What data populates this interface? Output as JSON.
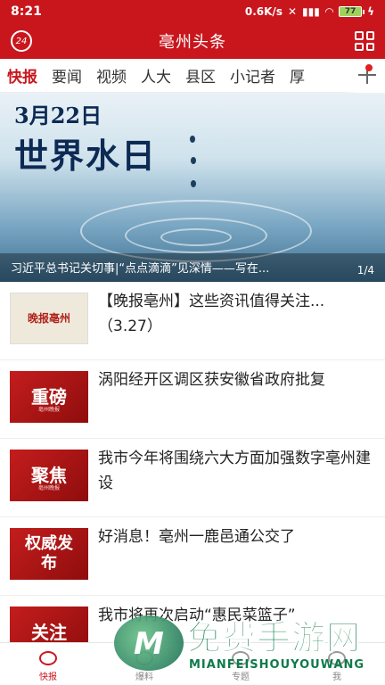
{
  "status_bar": {
    "time": "8:21",
    "net_speed": "0.6K/s",
    "battery_level": "77"
  },
  "header": {
    "badge": "24",
    "title": "亳州头条"
  },
  "tabs": [
    "快报",
    "要闻",
    "视频",
    "人大",
    "县区",
    "小记者",
    "厚"
  ],
  "active_tab": "快报",
  "banner": {
    "date_text": "3月22日",
    "headline_text": "世界水日",
    "caption": "习近平总书记关切事|“点点滴滴”见深情——写在...",
    "pager": "1/4"
  },
  "news": [
    {
      "thumb_text": "晚报亳州",
      "thumb_style": "paper",
      "title": "【晚报亳州】这些资讯值得关注...（3.27）"
    },
    {
      "thumb_text": "重磅",
      "thumb_style": "red",
      "title": "涡阳经开区调区获安徽省政府批复"
    },
    {
      "thumb_text": "聚焦",
      "thumb_style": "red",
      "title": "我市今年将围绕六大方面加强数字亳州建设"
    },
    {
      "thumb_text": "权威发布",
      "thumb_style": "red",
      "title": "好消息！亳州一鹿邑通公交了"
    },
    {
      "thumb_text": "关注",
      "thumb_style": "red",
      "title": "我市将再次启动“惠民菜篮子”"
    }
  ],
  "thumb_sublabel": "亳州晚报",
  "bottom_nav": [
    "快报",
    "爆料",
    "专题",
    "我"
  ],
  "watermark": {
    "big": "免费手游网",
    "small": "MIANFEISHOUYOUWANG"
  },
  "colors": {
    "brand_red": "#c9161d",
    "watermark_green": "#0f7a4a"
  }
}
